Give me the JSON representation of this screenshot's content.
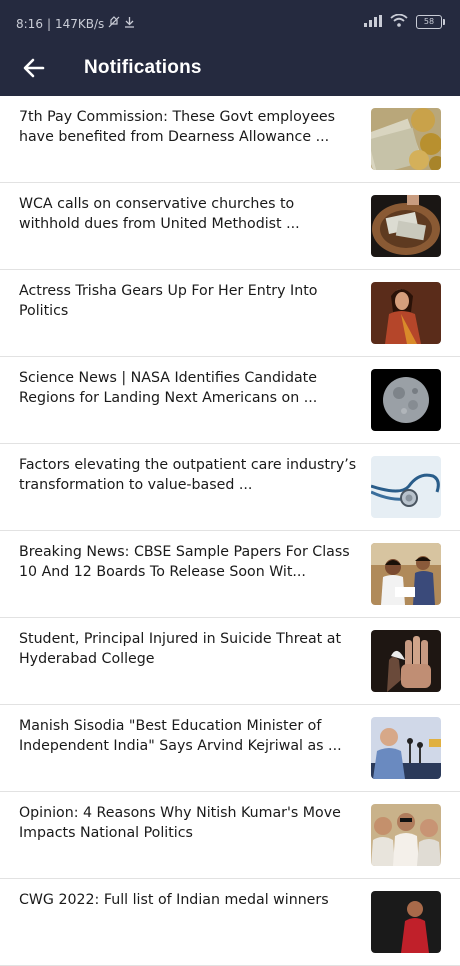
{
  "status_bar": {
    "time": "8:16",
    "network_speed": "147KB/s",
    "battery": "58"
  },
  "app_bar": {
    "title": "Notifications"
  },
  "notifications": [
    {
      "title": "7th Pay Commission: These Govt employees have benefited from Dearness Allowance ...",
      "thumbnail": "money-coins-image"
    },
    {
      "title": "WCA calls on conservative churches to withhold dues from United Methodist ...",
      "thumbnail": "offering-plate-image"
    },
    {
      "title": "Actress Trisha Gears Up For Her Entry Into Politics",
      "thumbnail": "actress-portrait-image"
    },
    {
      "title": "Science News | NASA Identifies Candidate Regions for Landing Next Americans on ...",
      "thumbnail": "moon-image"
    },
    {
      "title": "Factors elevating the outpatient care industry’s transformation to value-based ...",
      "thumbnail": "stethoscope-image"
    },
    {
      "title": "Breaking News: CBSE Sample Papers For Class 10 And 12 Boards To Release Soon Wit...",
      "thumbnail": "students-image"
    },
    {
      "title": "Student, Principal Injured in Suicide Threat at Hyderabad College",
      "thumbnail": "hand-image"
    },
    {
      "title": "Manish Sisodia \"Best Education Minister of Independent India\" Says Arvind Kejriwal as ...",
      "thumbnail": "speaker-image"
    },
    {
      "title": "Opinion: 4 Reasons Why Nitish Kumar's Move Impacts National Politics",
      "thumbnail": "politicians-image"
    },
    {
      "title": "CWG 2022: Full list of Indian medal winners",
      "thumbnail": "athlete-image"
    }
  ]
}
